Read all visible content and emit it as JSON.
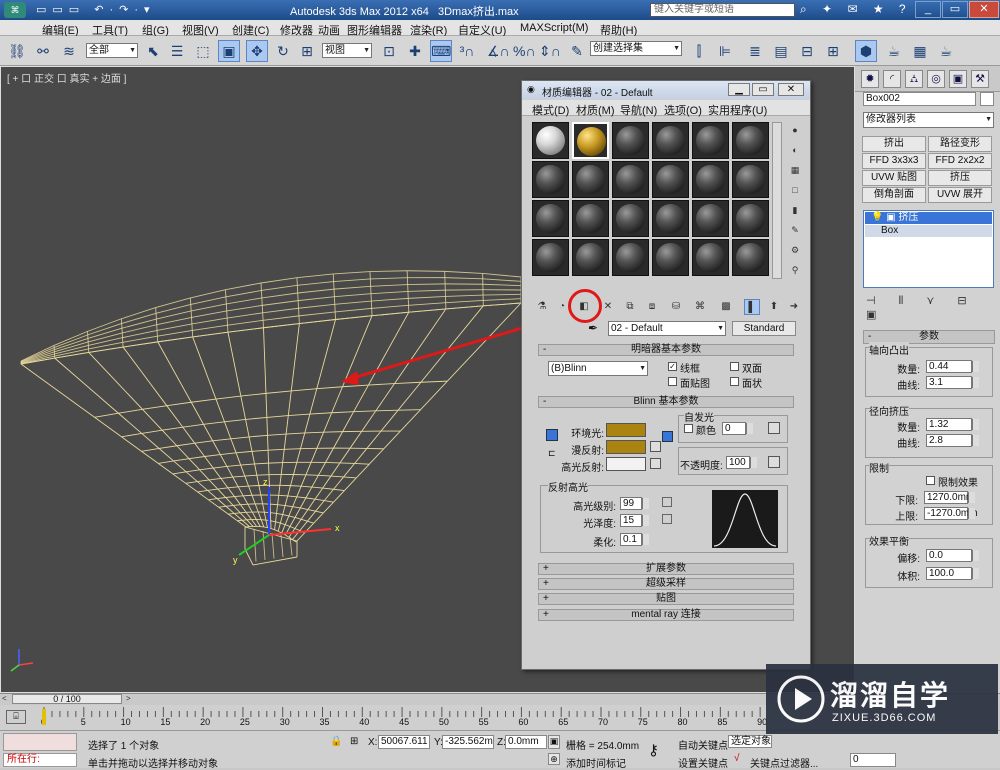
{
  "app": {
    "title": "Autodesk 3ds Max  2012 x64",
    "file": "3Dmax挤出.max",
    "search_placeholder": "键入关键字或短语"
  },
  "menu": [
    "编辑(E)",
    "工具(T)",
    "组(G)",
    "视图(V)",
    "创建(C)",
    "修改器",
    "动画",
    "图形编辑器",
    "渲染(R)",
    "自定义(U)",
    "MAXScript(M)",
    "帮助(H)"
  ],
  "toolbar": {
    "filter_value": "全部",
    "view_value": "视图",
    "named_selection": "创建选择集"
  },
  "viewport": {
    "label": "[ + ] 正交 ] 真实 + 边面 ]",
    "label_text": "[ + 口 正交 口 真实 + 边面 ]"
  },
  "command_panel": {
    "object_name": "Box002",
    "modifier_list": "修改器列表",
    "buttons": [
      "挤出",
      "路径变形",
      "FFD 3x3x3",
      "FFD 2x2x2",
      "UVW 贴图",
      "挤压",
      "倒角剖面",
      "UVW 展开"
    ],
    "stack": [
      "挤压",
      "Box"
    ],
    "rollout": "参数",
    "axial_bulge": {
      "title": "轴向凸出",
      "amount_label": "数量:",
      "amount": "0.44",
      "curve_label": "曲线:",
      "curve": "3.1"
    },
    "radial_squeeze": {
      "title": "径向挤压",
      "amount_label": "数量:",
      "amount": "1.32",
      "curve_label": "曲线:",
      "curve": "2.8"
    },
    "limits": {
      "title": "限制",
      "effect_label": "限制效果",
      "lower_label": "下限:",
      "lower": "1270.0mm",
      "upper_label": "上限:",
      "upper": "-1270.0mm"
    },
    "balance": {
      "title": "效果平衡",
      "bias_label": "偏移:",
      "bias": "0.0",
      "volume_label": "体积:",
      "volume": "100.0"
    }
  },
  "material_editor": {
    "title": "材质编辑器 - 02 - Default",
    "menu": [
      "模式(D)",
      "材质(M)",
      "导航(N)",
      "选项(O)",
      "实用程序(U)"
    ],
    "material_name": "02 - Default",
    "material_type": "Standard",
    "shader_rollout": "明暗器基本参数",
    "shader": "(B)Blinn",
    "wire_label": "线框",
    "two_sided_label": "双面",
    "face_map_label": "面贴图",
    "faceted_label": "面状",
    "blinn_rollout": "Blinn 基本参数",
    "self_illum_label": "自发光",
    "color_label": "颜色",
    "self_illum_value": "0",
    "ambient_label": "环境光:",
    "diffuse_label": "漫反射:",
    "specular_label": "高光反射:",
    "opacity_label": "不透明度:",
    "opacity": "100",
    "spec_hl_label": "反射高光",
    "spec_level_label": "高光级别:",
    "spec_level": "99",
    "gloss_label": "光泽度:",
    "gloss": "15",
    "soften_label": "柔化:",
    "soften": "0.1",
    "extra_rollouts": [
      "扩展参数",
      "超级采样",
      "贴图",
      "mental ray 连接"
    ],
    "colors": {
      "ambient": "#a98410",
      "diffuse": "#a98410",
      "specular": "#f2f2f2"
    }
  },
  "timeline": {
    "frame": "0 / 100",
    "ticks": [
      "0",
      "5",
      "10",
      "15",
      "20",
      "25",
      "30",
      "35",
      "40",
      "45",
      "50",
      "55",
      "60",
      "65",
      "70",
      "75",
      "80",
      "85",
      "90"
    ]
  },
  "status": {
    "mode": "所在行:",
    "selected": "选择了 1 个对象",
    "prompt": "单击并拖动以选择并移动对象",
    "x_label": "X:",
    "x": "50067.611",
    "y_label": "Y:",
    "y": "-325.562m",
    "z_label": "Z:",
    "z": "0.0mm",
    "grid": "栅格 = 254.0mm",
    "add_time_tag": "添加时间标记",
    "auto_key": "自动关键点",
    "set_key": "设置关键点",
    "selected_obj": "选定对象",
    "key_filters": "关键点过滤器...",
    "frame_field": "0"
  },
  "watermark": {
    "brand": "溜溜自学",
    "url": "ZIXUE.3D66.COM"
  },
  "annotation_color": "#e01818"
}
